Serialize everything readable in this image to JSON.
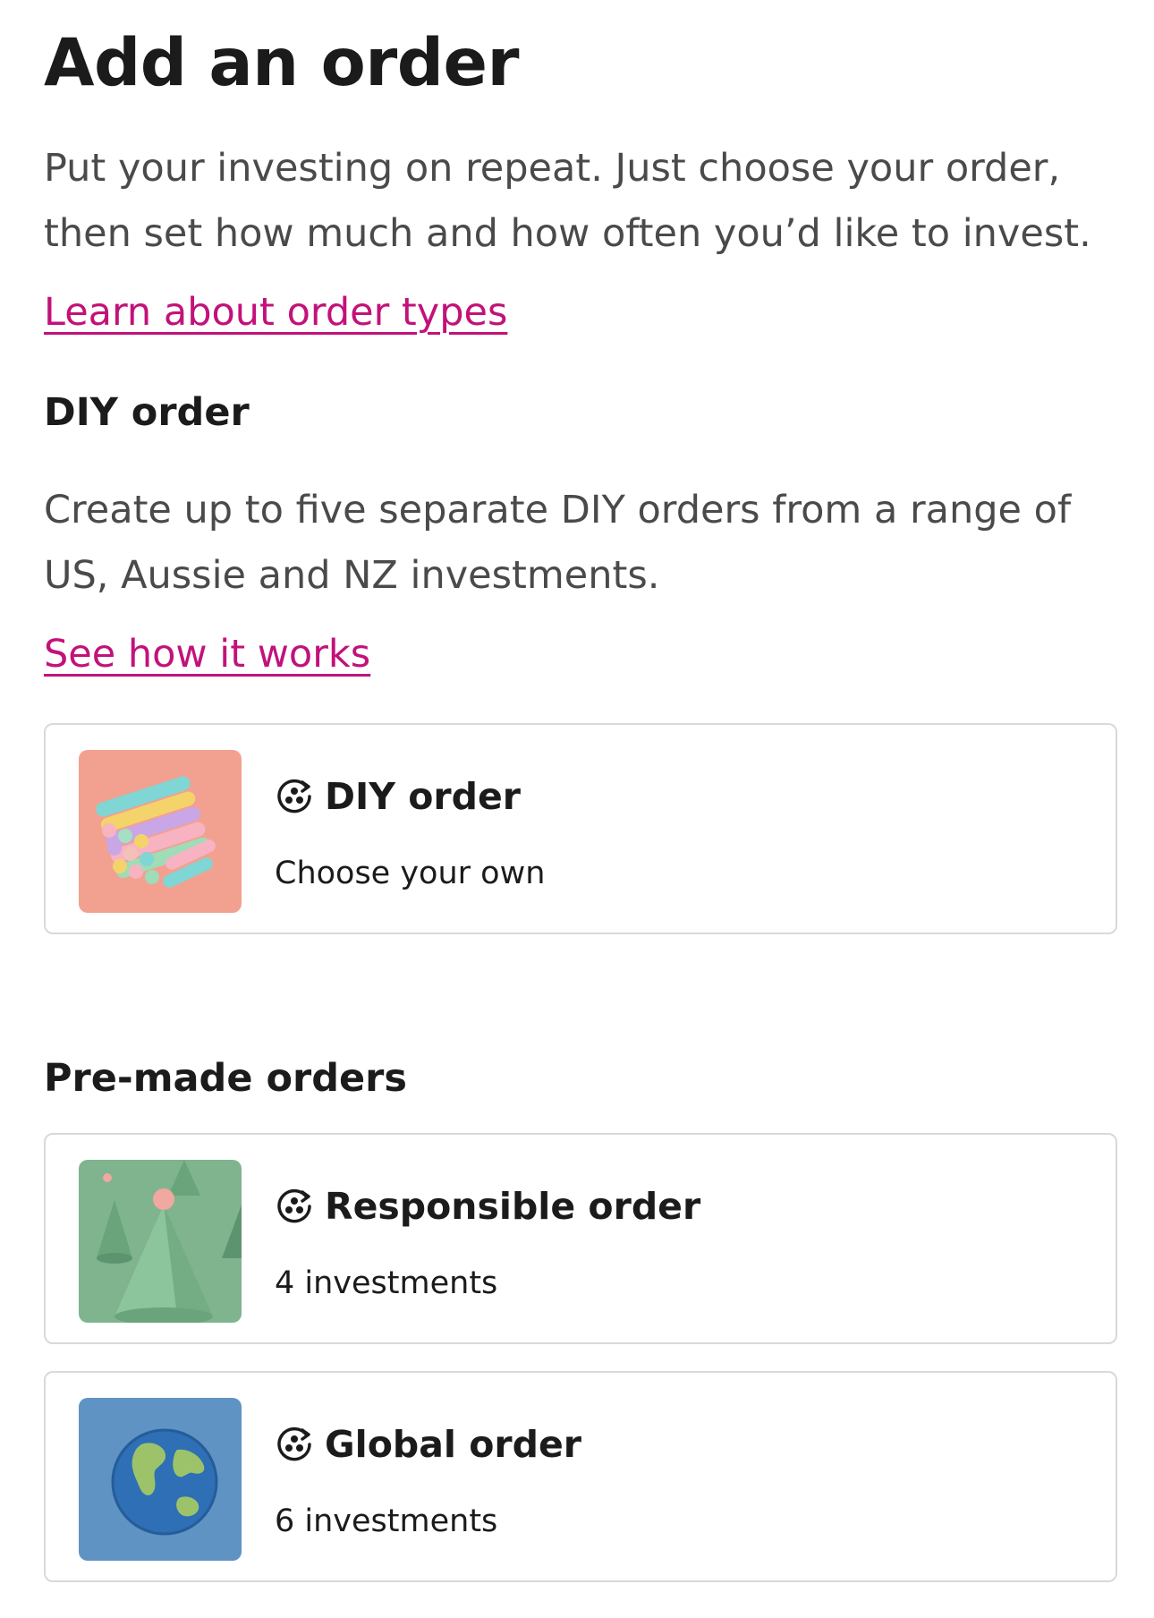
{
  "page": {
    "title": "Add an order",
    "intro": "Put your investing on repeat. Just choose your order, then set how much and how often you’d like to invest.",
    "learn_link": "Learn about order types"
  },
  "diy_section": {
    "heading": "DIY order",
    "description": "Create up to five separate DIY orders from a range of US, Aussie and NZ investments.",
    "how_link": "See how it works",
    "card": {
      "icon": "auto-invest-icon",
      "image": "colorful-chalk-sticks-image",
      "title": "DIY order",
      "subtitle": "Choose your own"
    }
  },
  "premade_section": {
    "heading": "Pre-made orders",
    "cards": [
      {
        "icon": "auto-invest-icon",
        "image": "green-cones-image",
        "title": "Responsible order",
        "subtitle": "4 investments"
      },
      {
        "icon": "auto-invest-icon",
        "image": "globe-image",
        "title": "Global order",
        "subtitle": "6 investments"
      }
    ]
  },
  "colors": {
    "link": "#c2127a",
    "text": "#1b1b1b",
    "muted": "#4a4a4a",
    "border": "#d9d9d9"
  }
}
